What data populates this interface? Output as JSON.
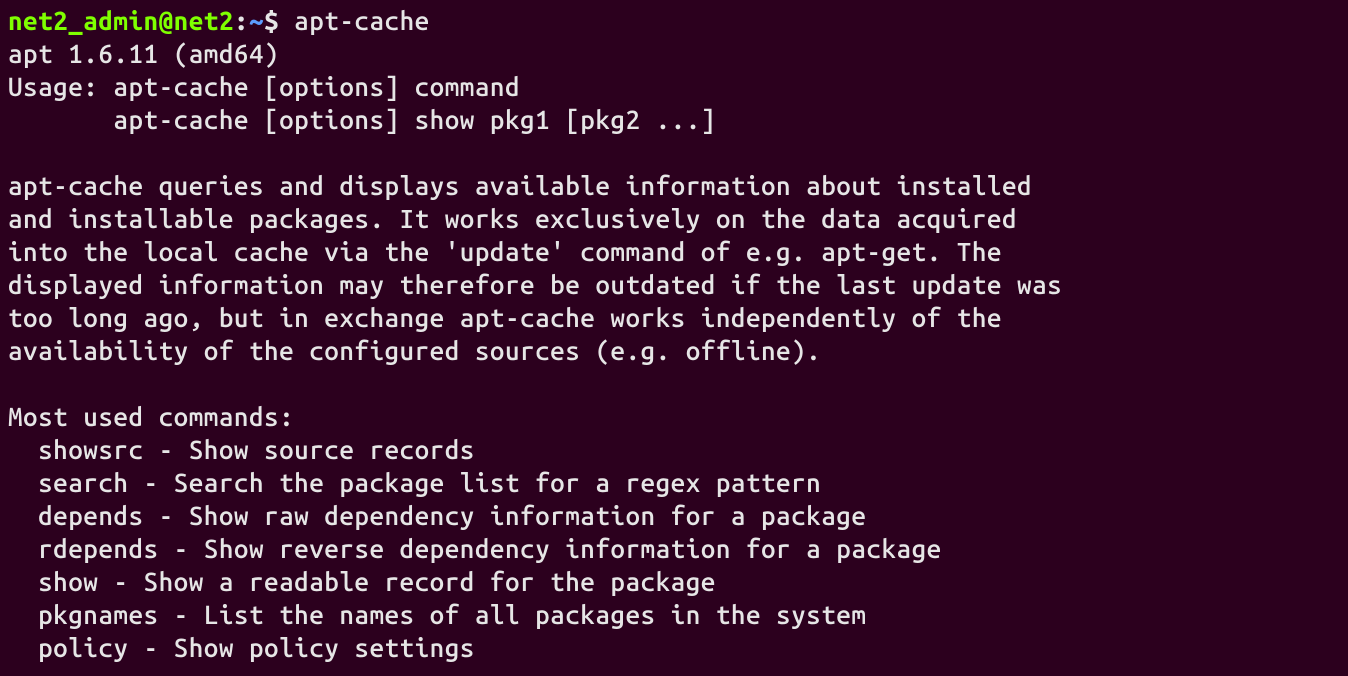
{
  "prompt": {
    "user": "net2_admin@net2",
    "sep": ":",
    "path": "~",
    "dollar": "$ "
  },
  "command": "apt-cache",
  "output": {
    "version": "apt 1.6.11 (amd64)",
    "usage1": "Usage: apt-cache [options] command",
    "usage2": "       apt-cache [options] show pkg1 [pkg2 ...]",
    "blank1": "",
    "desc1": "apt-cache queries and displays available information about installed",
    "desc2": "and installable packages. It works exclusively on the data acquired",
    "desc3": "into the local cache via the 'update' command of e.g. apt-get. The",
    "desc4": "displayed information may therefore be outdated if the last update was",
    "desc5": "too long ago, but in exchange apt-cache works independently of the",
    "desc6": "availability of the configured sources (e.g. offline).",
    "blank2": "",
    "most": "Most used commands:",
    "cmd1": "  showsrc - Show source records",
    "cmd2": "  search - Search the package list for a regex pattern",
    "cmd3": "  depends - Show raw dependency information for a package",
    "cmd4": "  rdepends - Show reverse dependency information for a package",
    "cmd5": "  show - Show a readable record for the package",
    "cmd6": "  pkgnames - List the names of all packages in the system",
    "cmd7": "  policy - Show policy settings"
  }
}
